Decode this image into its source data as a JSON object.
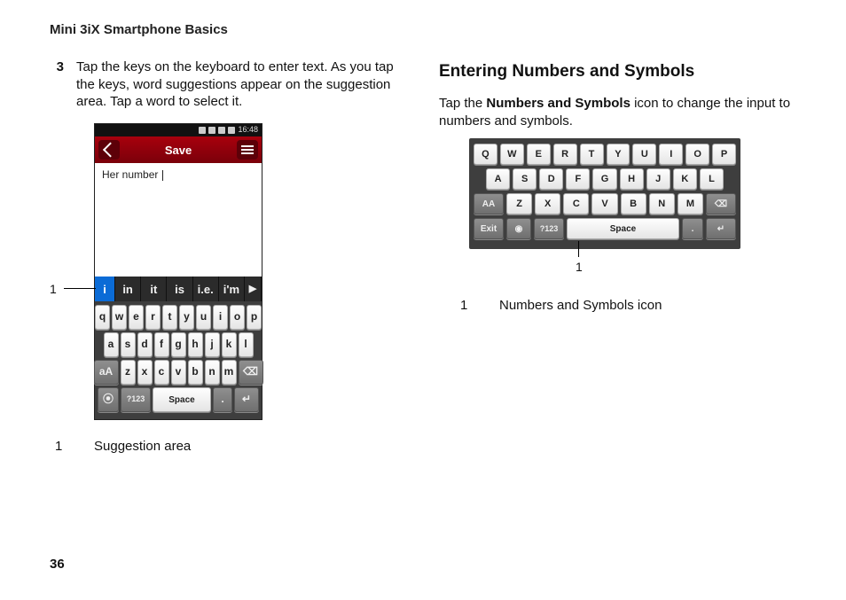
{
  "running_title": "Mini 3iX Smartphone Basics",
  "page_number": "36",
  "left": {
    "step_number": "3",
    "step_text": "Tap the keys on the keyboard to enter text. As you tap the keys, word suggestions appear on the suggestion area. Tap a word to select it.",
    "callout_number": "1",
    "legend_number": "1",
    "legend_text": "Suggestion area"
  },
  "right": {
    "heading": "Entering Numbers and Symbols",
    "para_pre": "Tap the ",
    "para_bold": "Numbers and Symbols",
    "para_post": " icon to change the input to numbers and symbols.",
    "callout_number": "1",
    "legend_number": "1",
    "legend_text": "Numbers and Symbols icon"
  },
  "phone": {
    "time": "16:48",
    "title": "Save",
    "entered_text": "Her number ",
    "suggestions": [
      "i",
      "in",
      "it",
      "is",
      "i.e.",
      "i'm"
    ],
    "more_glyph": "▶",
    "rows": {
      "r1": [
        "q",
        "w",
        "e",
        "r",
        "t",
        "y",
        "u",
        "i",
        "o",
        "p"
      ],
      "r2": [
        "a",
        "s",
        "d",
        "f",
        "g",
        "h",
        "j",
        "k",
        "l"
      ],
      "r3_shift": "aA",
      "r3": [
        "z",
        "x",
        "c",
        "v",
        "b",
        "n",
        "m"
      ],
      "r3_bksp": "⌫",
      "r4_lang": "⦿",
      "r4_sym": "?123",
      "r4_space": "Space",
      "r4_dot": ".",
      "r4_enter": "↵"
    }
  },
  "kb2": {
    "rows": {
      "r1": [
        "Q",
        "W",
        "E",
        "R",
        "T",
        "Y",
        "U",
        "I",
        "O",
        "P"
      ],
      "r2": [
        "A",
        "S",
        "D",
        "F",
        "G",
        "H",
        "J",
        "K",
        "L"
      ],
      "r3_shift": "AA",
      "r3": [
        "Z",
        "X",
        "C",
        "V",
        "B",
        "N",
        "M"
      ],
      "r3_bksp": "⌫",
      "r4_exit": "Exit",
      "r4_lang": "◉",
      "r4_sym": "?123",
      "r4_space": "Space",
      "r4_dot": ".",
      "r4_enter": "↵"
    }
  }
}
